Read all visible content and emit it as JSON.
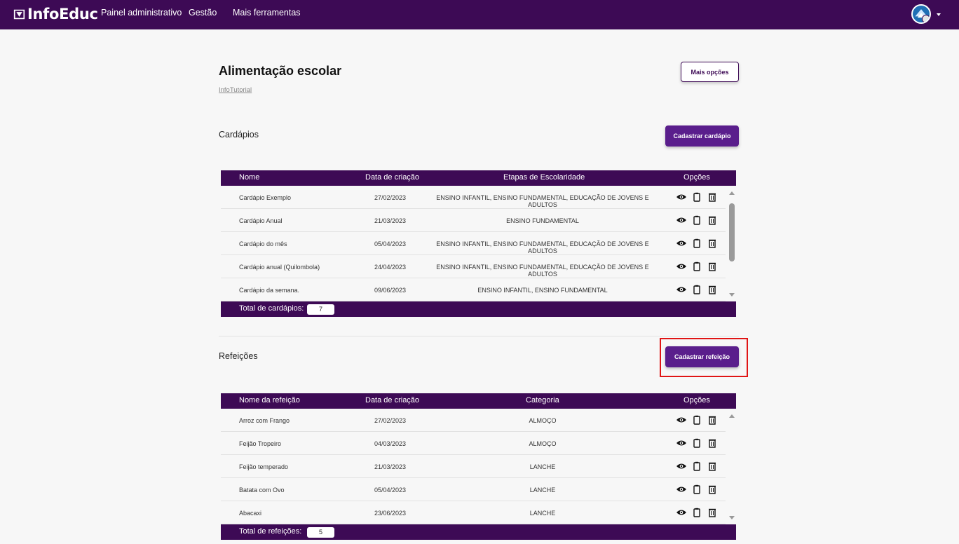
{
  "topbar": {
    "logo_text": "InfoEduc",
    "nav": [
      "Painel administrativo",
      "Gestão",
      "Mais ferramentas"
    ]
  },
  "page": {
    "title": "Alimentação escolar",
    "tutorial_link": "InfoTutorial",
    "more_options": "Mais opções"
  },
  "cardapios": {
    "title": "Cardápios",
    "add_button": "Cadastrar cardápio",
    "headers": [
      "Nome",
      "Data de criação",
      "Etapas de Escolaridade",
      "Opções"
    ],
    "rows": [
      {
        "name": "Cardápio Exemplo",
        "date": "27/02/2023",
        "info": "ENSINO INFANTIL, ENSINO FUNDAMENTAL, EDUCAÇÃO DE JOVENS E ADULTOS"
      },
      {
        "name": "Cardápio Anual",
        "date": "21/03/2023",
        "info": "ENSINO FUNDAMENTAL"
      },
      {
        "name": "Cardápio do mês",
        "date": "05/04/2023",
        "info": "ENSINO INFANTIL, ENSINO FUNDAMENTAL, EDUCAÇÃO DE JOVENS E ADULTOS"
      },
      {
        "name": "Cardápio anual (Quilombola)",
        "date": "24/04/2023",
        "info": "ENSINO INFANTIL, ENSINO FUNDAMENTAL, EDUCAÇÃO DE JOVENS E ADULTOS"
      },
      {
        "name": "Cardápio da semana.",
        "date": "09/06/2023",
        "info": "ENSINO INFANTIL, ENSINO FUNDAMENTAL"
      }
    ],
    "total_label": "Total de cardápios:",
    "total": "7"
  },
  "refeicoes": {
    "title": "Refeições",
    "add_button": "Cadastrar refeição",
    "headers": [
      "Nome da refeição",
      "Data de criação",
      "Categoria",
      "Opções"
    ],
    "rows": [
      {
        "name": "Arroz com Frango",
        "date": "27/02/2023",
        "info": "ALMOÇO"
      },
      {
        "name": "Feijão Tropeiro",
        "date": "04/03/2023",
        "info": "ALMOÇO"
      },
      {
        "name": "Feijão temperado",
        "date": "21/03/2023",
        "info": "LANCHE"
      },
      {
        "name": "Batata com Ovo",
        "date": "05/04/2023",
        "info": "LANCHE"
      },
      {
        "name": "Abacaxi",
        "date": "23/06/2023",
        "info": "LANCHE"
      }
    ],
    "total_label": "Total de refeições:",
    "total": "5"
  },
  "colors": {
    "brand": "#3d0a55",
    "button": "#5a1e8c",
    "highlight": "#e01515"
  },
  "icons": [
    "logo-icon",
    "user-avatar-icon",
    "eye-icon",
    "copy-icon",
    "trash-icon"
  ]
}
